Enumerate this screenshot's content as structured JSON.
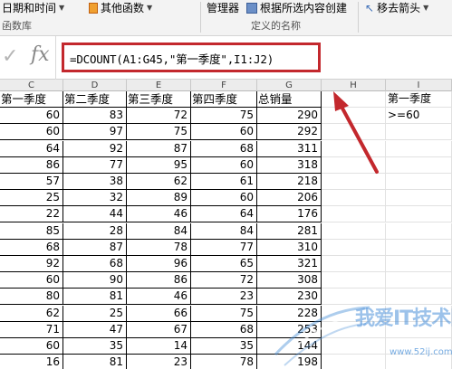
{
  "ribbon": {
    "items": [
      {
        "label": "日期和时间"
      },
      {
        "label": "其他函数"
      },
      {
        "label": "管理器"
      },
      {
        "label": "根据所选内容创建"
      },
      {
        "label": "移去箭头"
      }
    ],
    "group_labels": [
      "函数库",
      "定义的名称"
    ]
  },
  "formula_bar": {
    "formula": "=DCOUNT(A1:G45,\"第一季度\",I1:J2)"
  },
  "columns": [
    "C",
    "D",
    "E",
    "F",
    "G",
    "H",
    "I"
  ],
  "table": {
    "headers": [
      "第一季度",
      "第二季度",
      "第三季度",
      "第四季度",
      "总销量"
    ],
    "rows": [
      [
        60,
        83,
        72,
        75,
        290
      ],
      [
        60,
        97,
        75,
        60,
        292
      ],
      [
        64,
        92,
        87,
        68,
        311
      ],
      [
        86,
        77,
        95,
        60,
        318
      ],
      [
        57,
        38,
        62,
        61,
        218
      ],
      [
        25,
        32,
        89,
        60,
        206
      ],
      [
        22,
        44,
        46,
        64,
        176
      ],
      [
        85,
        28,
        84,
        84,
        281
      ],
      [
        68,
        87,
        78,
        77,
        310
      ],
      [
        92,
        68,
        96,
        65,
        321
      ],
      [
        60,
        90,
        86,
        72,
        308
      ],
      [
        80,
        81,
        46,
        23,
        230
      ],
      [
        62,
        25,
        66,
        75,
        228
      ],
      [
        71,
        47,
        67,
        68,
        253
      ],
      [
        60,
        35,
        14,
        35,
        144
      ],
      [
        16,
        81,
        23,
        78,
        198
      ]
    ]
  },
  "criteria": {
    "header": "第一季度",
    "value": ">=60"
  },
  "watermark": {
    "text": "我爱IT技术网",
    "url": "www.52ij.com"
  },
  "colors": {
    "highlight_border": "#c3282d",
    "arrow": "#c3282d",
    "watermark": "#4a90d8"
  }
}
